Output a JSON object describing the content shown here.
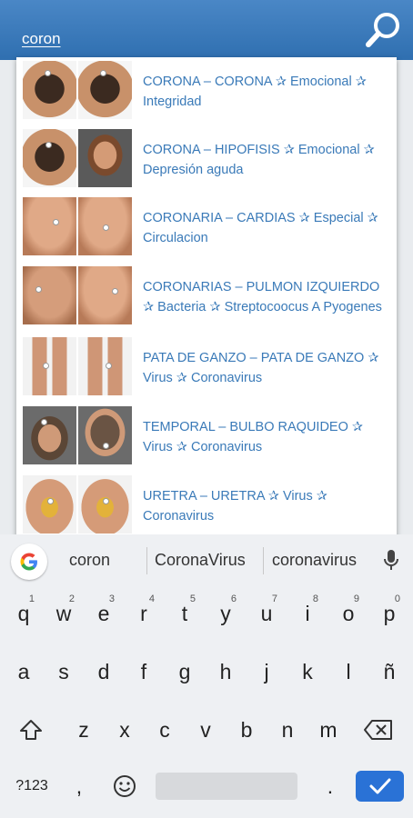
{
  "search": {
    "query": "coron",
    "icon": "magnifier-icon"
  },
  "results": [
    {
      "text": "CORONA – CORONA ✰ Emocional ✰ Integridad",
      "thumbs": [
        "head-top",
        "head-top"
      ]
    },
    {
      "text": "CORONA – HIPOFISIS ✰ Emocional ✰ Depresión aguda",
      "thumbs": [
        "head-top",
        "face"
      ]
    },
    {
      "text": "CORONARIA – CARDIAS ✰ Especial ✰ Circulacion",
      "thumbs": [
        "torso",
        "torso"
      ]
    },
    {
      "text": "CORONARIAS – PULMON IZQUIERDO ✰ Bacteria ✰ Streptocoocus A Pyogenes",
      "thumbs": [
        "back",
        "torso"
      ]
    },
    {
      "text": "PATA DE GANZO – PATA DE GANZO ✰ Virus ✰ Coronavirus",
      "thumbs": [
        "legs",
        "legs"
      ]
    },
    {
      "text": "TEMPORAL – BULBO RAQUIDEO ✰ Virus ✰ Coronavirus",
      "thumbs": [
        "headside",
        "headback"
      ]
    },
    {
      "text": "URETRA – URETRA ✰ Virus ✰ Coronavirus",
      "thumbs": [
        "hips",
        "hips"
      ]
    }
  ],
  "keyboard": {
    "suggestions": [
      "coron",
      "CoronaVirus",
      "coronavirus"
    ],
    "row1": [
      "q",
      "w",
      "e",
      "r",
      "t",
      "y",
      "u",
      "i",
      "o",
      "p"
    ],
    "row1_hints": [
      "1",
      "2",
      "3",
      "4",
      "5",
      "6",
      "7",
      "8",
      "9",
      "0"
    ],
    "row2": [
      "a",
      "s",
      "d",
      "f",
      "g",
      "h",
      "j",
      "k",
      "l",
      "ñ"
    ],
    "row3": [
      "z",
      "x",
      "c",
      "v",
      "b",
      "n",
      "m"
    ],
    "symbols_label": "?123",
    "comma": ",",
    "period": "."
  }
}
